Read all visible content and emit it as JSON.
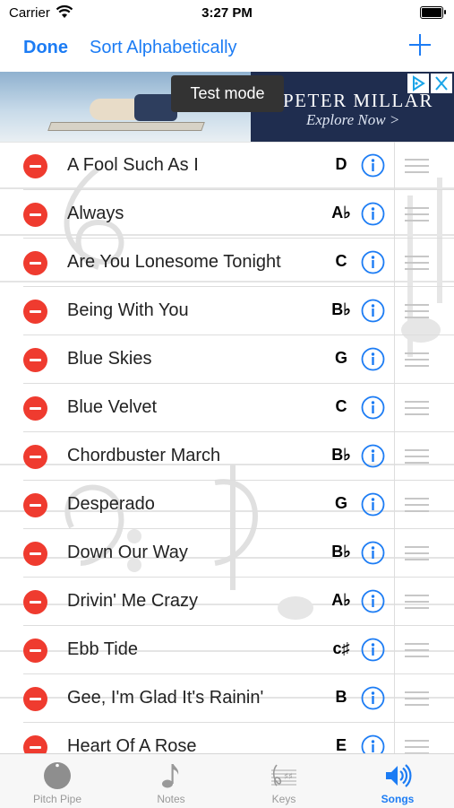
{
  "status_bar": {
    "carrier": "Carrier",
    "time": "3:27 PM"
  },
  "nav": {
    "done_label": "Done",
    "sort_label": "Sort Alphabetically",
    "add_icon": "plus-icon"
  },
  "ad": {
    "brand": "PETER MILLAR",
    "cta": "Explore Now >",
    "test_mode": "Test mode"
  },
  "songs": [
    {
      "title": "A Fool Such As I",
      "key": "D"
    },
    {
      "title": "Always",
      "key": "A♭"
    },
    {
      "title": "Are You Lonesome Tonight",
      "key": "C"
    },
    {
      "title": "Being With You",
      "key": "B♭"
    },
    {
      "title": "Blue Skies",
      "key": "G"
    },
    {
      "title": "Blue Velvet",
      "key": "C"
    },
    {
      "title": "Chordbuster March",
      "key": "B♭"
    },
    {
      "title": "Desperado",
      "key": "G"
    },
    {
      "title": "Down Our Way",
      "key": "B♭"
    },
    {
      "title": "Drivin' Me Crazy",
      "key": "A♭"
    },
    {
      "title": "Ebb Tide",
      "key": "c♯"
    },
    {
      "title": "Gee, I'm Glad It's Rainin'",
      "key": "B"
    },
    {
      "title": "Heart Of A Rose",
      "key": "E"
    }
  ],
  "tabs": [
    {
      "label": "Pitch Pipe",
      "icon": "pitch-pipe-icon"
    },
    {
      "label": "Notes",
      "icon": "music-note-icon"
    },
    {
      "label": "Keys",
      "icon": "staff-keys-icon"
    },
    {
      "label": "Songs",
      "icon": "speaker-icon"
    }
  ],
  "colors": {
    "accent": "#1c7cf4",
    "delete": "#ef3b2f",
    "ad_bg": "#1f2d4f"
  }
}
